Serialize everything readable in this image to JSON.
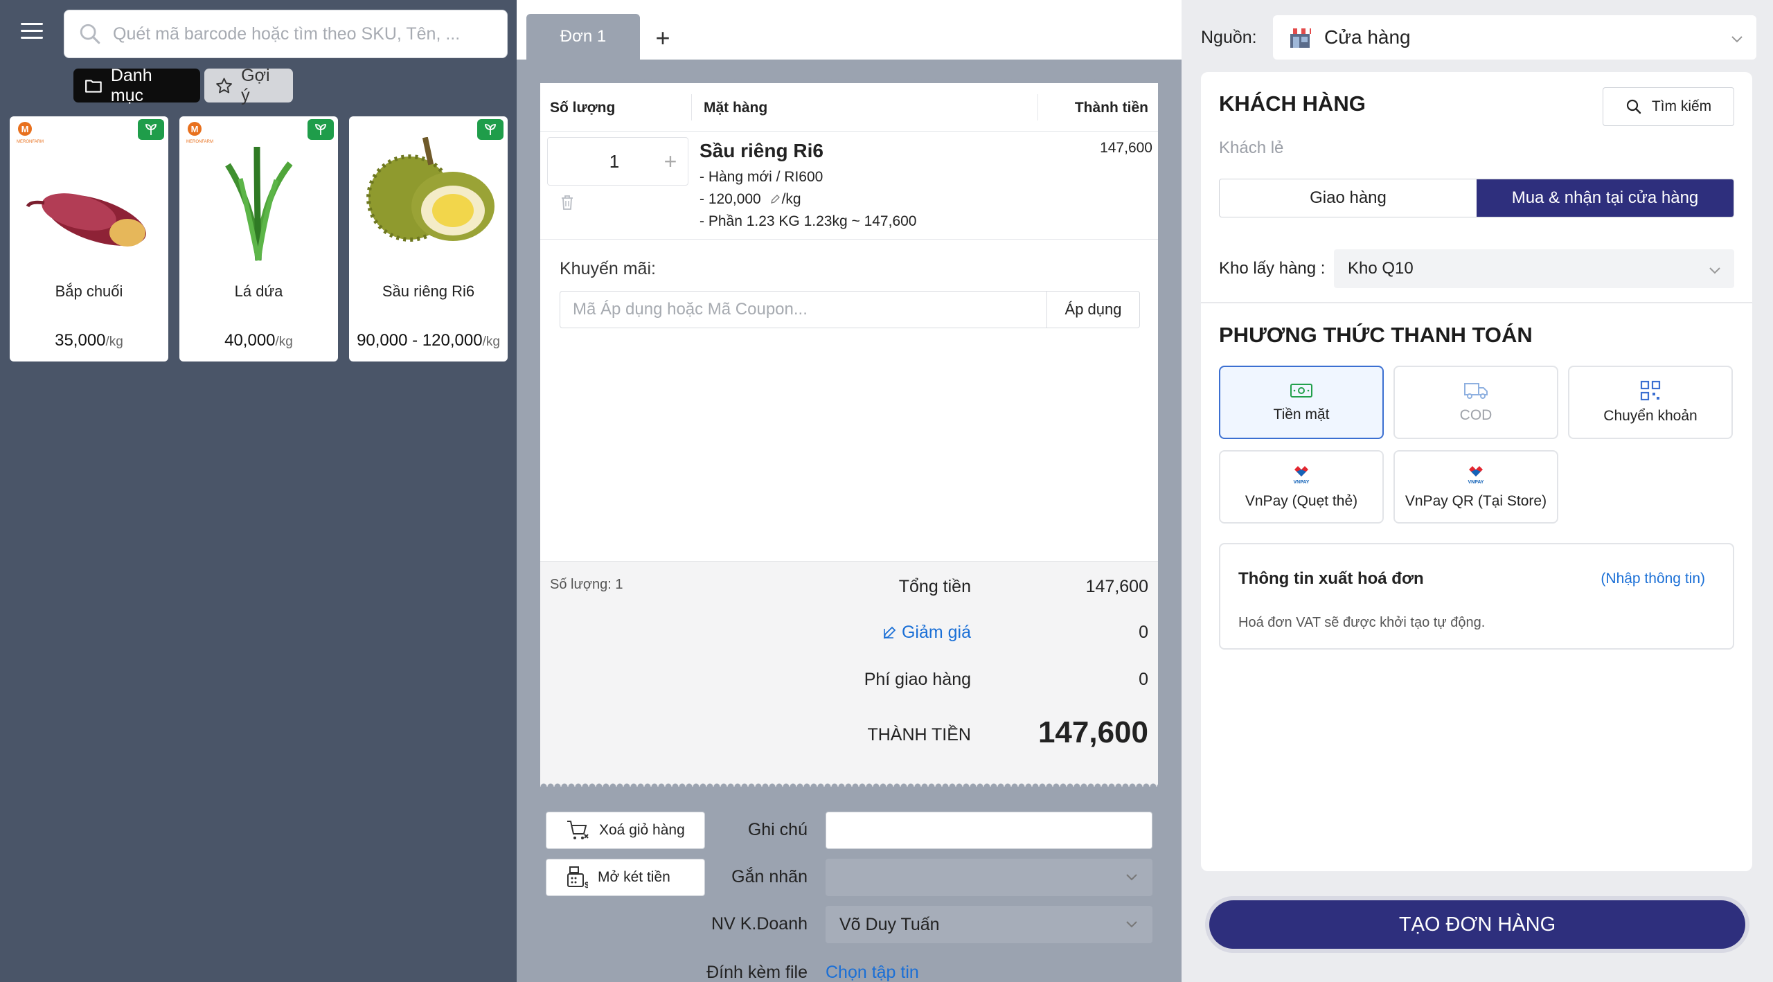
{
  "search": {
    "placeholder": "Quét mã barcode hoặc tìm theo SKU, Tên, ..."
  },
  "chips": {
    "category": "Danh mục",
    "suggest": "Gợi ý"
  },
  "products": [
    {
      "name": "Bắp chuối",
      "price": "35,000",
      "unit": "/kg"
    },
    {
      "name": "Lá dứa",
      "price": "40,000",
      "unit": "/kg"
    },
    {
      "name": "Sầu riêng Ri6",
      "price": "90,000 - 120,000",
      "unit": "/kg"
    }
  ],
  "brand": {
    "logo_text": "MERONFARM",
    "accent": "#e8701d",
    "leaf_badge_color": "#1f9d4a"
  },
  "tabs": {
    "active": "Đơn 1",
    "add": "+"
  },
  "receipt": {
    "headers": {
      "qty": "Số lượng",
      "item": "Mặt hàng",
      "total": "Thành tiền"
    },
    "item": {
      "qty": "1",
      "plus": "+",
      "name": "Sầu riêng Ri6",
      "line1": "- Hàng mới / RI600",
      "line2_prefix": "- 120,000",
      "line2_suffix": "/kg",
      "line3": "- Phần 1.23 KG 1.23kg ~ 147,600",
      "price": "147,600"
    },
    "promo": {
      "label": "Khuyến mãi:",
      "placeholder": "Mã Áp dụng hoặc Mã Coupon...",
      "apply": "Áp dụng"
    },
    "summary": {
      "count": "Số lượng: 1",
      "total_label": "Tổng tiền",
      "total_value": "147,600",
      "discount_label": "Giảm giá",
      "discount_value": "0",
      "shipping_label": "Phí giao hàng",
      "shipping_value": "0",
      "grand_label": "THÀNH TIỀN",
      "grand_value": "147,600"
    }
  },
  "actions": {
    "clear_cart": "Xoá giỏ hàng",
    "open_drawer": "Mở két tiền"
  },
  "form": {
    "note_label": "Ghi chú",
    "tag_label": "Gắn nhãn",
    "sales_label": "NV K.Doanh",
    "sales_value": "Võ Duy Tuấn",
    "file_label": "Đính kèm file",
    "file_link": "Chọn tập tin"
  },
  "source": {
    "label": "Nguồn:",
    "value": "Cửa hàng"
  },
  "customer": {
    "title": "KHÁCH HÀNG",
    "search": "Tìm kiếm",
    "guest": "Khách lẻ",
    "delivery": "Giao hàng",
    "pickup": "Mua & nhận tại cửa hàng",
    "warehouse_label": "Kho lấy hàng",
    "warehouse_value": "Kho Q10"
  },
  "payment": {
    "title": "PHƯƠNG THỨC THANH TOÁN",
    "methods": [
      "Tiền mặt",
      "COD",
      "Chuyển khoản",
      "VnPay (Quẹt thẻ)",
      "VnPay QR (Tại Store)"
    ],
    "selected": "Tiền mặt",
    "vnpay_logo": "VNPAY"
  },
  "invoice": {
    "title": "Thông tin xuất hoá đơn",
    "link": "(Nhập thông tin)",
    "note": "Hoá đơn VAT sẽ được khởi tạo tự động."
  },
  "create_button": "TẠO ĐƠN HÀNG",
  "colors": {
    "primary": "#2e2f7d",
    "link": "#1a6fd6",
    "sidebar": "#4a5568",
    "cart_bg": "#9ba3b0"
  }
}
